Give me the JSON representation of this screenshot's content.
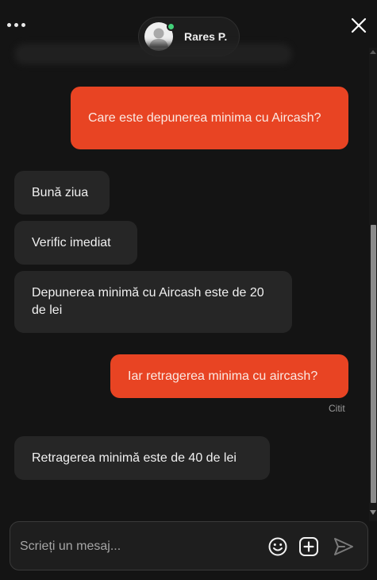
{
  "header": {
    "agent_name": "Rares P.",
    "status_color": "#43d17a",
    "menu_icon": "ellipsis-icon",
    "close_icon": "close-icon"
  },
  "messages": [
    {
      "direction": "out",
      "text": "Care este depunerea minima cu Aircash?"
    },
    {
      "direction": "in",
      "text": "Bună ziua"
    },
    {
      "direction": "in",
      "text": "Verific imediat"
    },
    {
      "direction": "in",
      "text": "Depunerea minimă cu Aircash este de 20 de lei"
    },
    {
      "direction": "out",
      "text": "Iar retragerea minima cu aircash?"
    },
    {
      "direction": "in",
      "text": "Retragerea minimă este de 40 de lei"
    }
  ],
  "read_receipt": "Citit",
  "composer": {
    "placeholder": "Scrieți un mesaj...",
    "value": "",
    "icons": [
      "emoji-icon",
      "attach-plus-icon",
      "send-icon"
    ]
  },
  "colors": {
    "background": "#141414",
    "outgoing_bubble": "#e84423",
    "incoming_bubble": "#262626"
  }
}
